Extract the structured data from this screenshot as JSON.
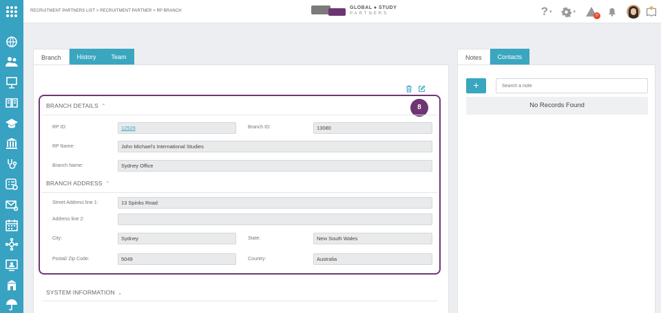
{
  "breadcrumb": "RECRUITMENT PARTNERS LIST > RECRUITMENT PARTNER > RP BRANCH",
  "logo": {
    "line1": "GLOBAL ● STUDY",
    "line2": "PARTNERS"
  },
  "notifications": {
    "count": "27"
  },
  "left_tabs": [
    {
      "label": "Branch",
      "active": true
    },
    {
      "label": "History",
      "active": false
    },
    {
      "label": "Team",
      "active": false
    }
  ],
  "right_tabs": [
    {
      "label": "Notes",
      "active": true
    },
    {
      "label": "Contacts",
      "active": false
    }
  ],
  "badge": "8",
  "branch_details": {
    "title": "BRANCH DETAILS",
    "rp_id_label": "RP ID:",
    "rp_id": "12529",
    "branch_id_label": "Branch ID:",
    "branch_id": "13080",
    "rp_name_label": "RP Name:",
    "rp_name": "John Michael's International Studies",
    "branch_name_label": "Branch Name:",
    "branch_name": "Sydney Office"
  },
  "branch_address": {
    "title": "BRANCH ADDRESS",
    "street1_label": "Street Address line 1:",
    "street1": "13 Spinks Road",
    "address2_label": "Address line 2:",
    "address2": "",
    "city_label": "City:",
    "city": "Sydney",
    "state_label": "State:",
    "state": "New South Wales",
    "postal_label": "Postal/ Zip Code:",
    "postal": "5049",
    "country_label": "Country:",
    "country": "Australia"
  },
  "system_information": {
    "title": "SYSTEM INFORMATION"
  },
  "notes": {
    "add_label": "+",
    "search_placeholder": "Search a note",
    "empty_text": "No Records Found"
  },
  "colors": {
    "sidebar": "#37a2c2",
    "accent": "#3aa6c0",
    "highlight": "#6d3571"
  }
}
